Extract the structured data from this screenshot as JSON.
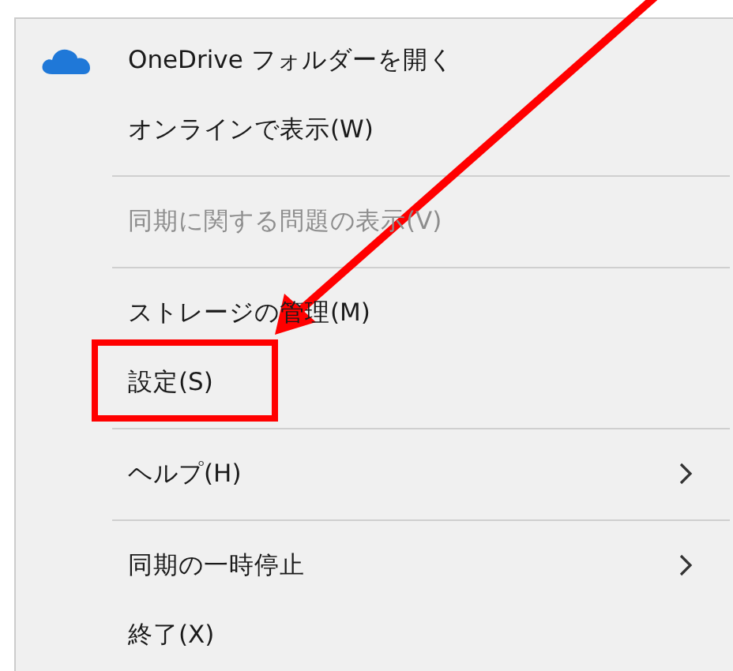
{
  "menu": {
    "groups": [
      [
        {
          "label": "OneDrive フォルダーを開く",
          "kind": "with-icon",
          "disabled": false,
          "submenu": false,
          "highlighted": false
        },
        {
          "label": "オンラインで表示(W)",
          "kind": "plain",
          "disabled": false,
          "submenu": false,
          "highlighted": false
        }
      ],
      [
        {
          "label": "同期に関する問題の表示(V)",
          "kind": "plain",
          "disabled": true,
          "submenu": false,
          "highlighted": false
        }
      ],
      [
        {
          "label": "ストレージの管理(M)",
          "kind": "plain",
          "disabled": false,
          "submenu": false,
          "highlighted": false
        },
        {
          "label": "設定(S)",
          "kind": "plain",
          "disabled": false,
          "submenu": false,
          "highlighted": true
        }
      ],
      [
        {
          "label": "ヘルプ(H)",
          "kind": "plain",
          "disabled": false,
          "submenu": true,
          "highlighted": false
        }
      ],
      [
        {
          "label": "同期の一時停止",
          "kind": "plain",
          "disabled": false,
          "submenu": true,
          "highlighted": false
        },
        {
          "label": "終了(X)",
          "kind": "plain",
          "disabled": false,
          "submenu": false,
          "highlighted": false
        }
      ]
    ]
  }
}
